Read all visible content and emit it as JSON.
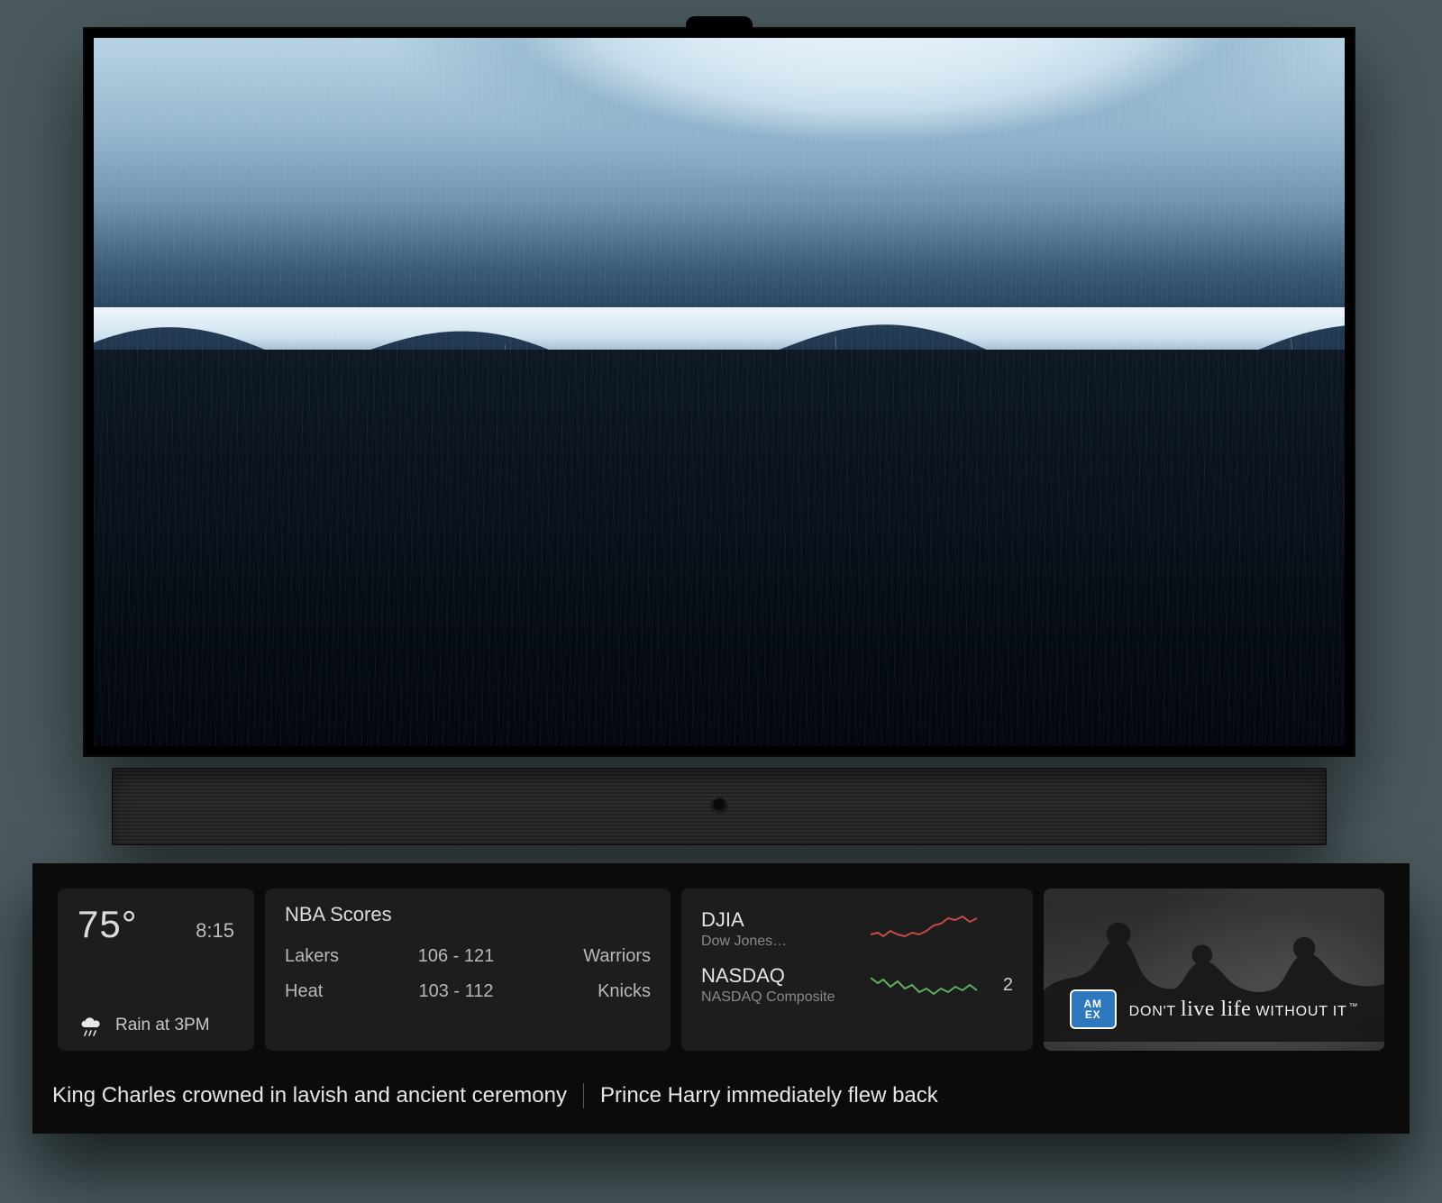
{
  "wallpaper": {
    "name": "ocean-aerial"
  },
  "weather": {
    "temp": "75°",
    "time": "8:15",
    "summary": "Rain at 3PM",
    "icon": "rain-cloud-icon"
  },
  "scores": {
    "title": "NBA Scores",
    "rows": [
      {
        "team_a": "Lakers",
        "score": "106 - 121",
        "team_b": "Warriors"
      },
      {
        "team_a": "Heat",
        "score": "103 - 112",
        "team_b": "Knicks"
      }
    ]
  },
  "stocks": {
    "rows": [
      {
        "symbol": "DJIA",
        "name": "Dow Jones…",
        "trend": "down",
        "color": "#c64b45",
        "price_fragment": ""
      },
      {
        "symbol": "NASDAQ",
        "name": "NASDAQ Composite",
        "trend": "up",
        "color": "#5fae61",
        "price_fragment": "2"
      }
    ]
  },
  "ad": {
    "brand_badge_text": "AM\nEX",
    "line_pre": "DON'T",
    "line_script": "live life",
    "line_post": "WITHOUT IT",
    "tm": "™"
  },
  "ticker": {
    "items": [
      "King Charles crowned in lavish and ancient ceremony",
      "Prince Harry immediately flew back"
    ]
  }
}
